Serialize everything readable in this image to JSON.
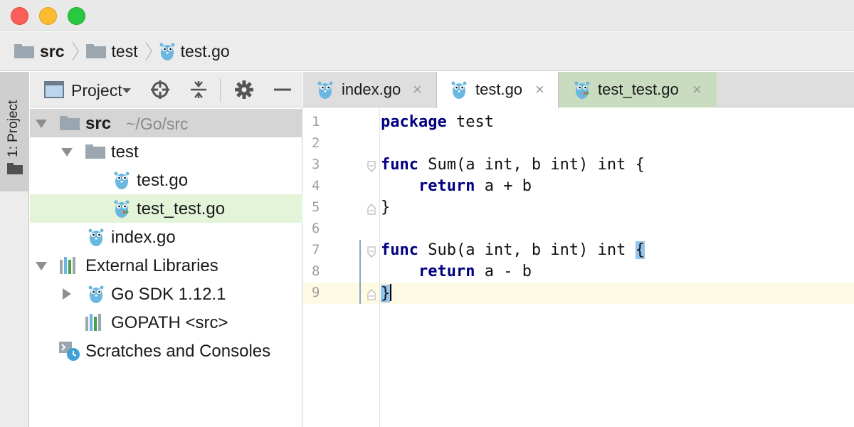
{
  "breadcrumb": {
    "items": [
      {
        "label": "src",
        "icon": "folder-icon"
      },
      {
        "label": "test",
        "icon": "folder-icon"
      },
      {
        "label": "test.go",
        "icon": "gopher-icon"
      }
    ]
  },
  "toolstrip": {
    "project_tab_label": "1: Project"
  },
  "project_panel": {
    "view_label": "Project",
    "tree": [
      {
        "label": "src",
        "path": "~/Go/src",
        "expanded": true,
        "icon": "folder-icon",
        "selected": "gray"
      },
      {
        "label": "test",
        "expanded": true,
        "icon": "folder-icon"
      },
      {
        "label": "test.go",
        "icon": "gopher-icon"
      },
      {
        "label": "test_test.go",
        "icon": "gopher-test-icon",
        "selected": "green"
      },
      {
        "label": "index.go",
        "icon": "gopher-icon"
      },
      {
        "label": "External Libraries",
        "expanded": true,
        "icon": "library-icon"
      },
      {
        "label": "Go SDK 1.12.1",
        "expanded": false,
        "icon": "gopher-icon"
      },
      {
        "label": "GOPATH <src>",
        "icon": "library-icon"
      },
      {
        "label": "Scratches and Consoles",
        "icon": "scratches-icon"
      }
    ]
  },
  "editor": {
    "tabs": [
      {
        "label": "index.go",
        "active": false,
        "close": "×"
      },
      {
        "label": "test.go",
        "active": true,
        "close": "×"
      },
      {
        "label": "test_test.go",
        "active": false,
        "close": "×"
      }
    ],
    "line_numbers": [
      "1",
      "2",
      "3",
      "4",
      "5",
      "6",
      "7",
      "8",
      "9"
    ],
    "code": {
      "l1_kw": "package",
      "l1_rest": " test",
      "l3_kw": "func",
      "l3_rest": " Sum(a int, b int) int {",
      "l4_kw": "return",
      "l4_rest": " a + b",
      "l5": "}",
      "l7_kw": "func",
      "l7_rest": " Sub(a int, b int) int ",
      "l7_brace": "{",
      "l8_kw": "return",
      "l8_rest": " a - b",
      "l9_brace": "}"
    },
    "current_line": 9
  },
  "colors": {
    "keyword": "#000080",
    "brace_highlight": "#93c4ec",
    "current_line": "#fffae3",
    "selected_green": "#e3f4d9",
    "gopher": "#6ab7e0"
  }
}
